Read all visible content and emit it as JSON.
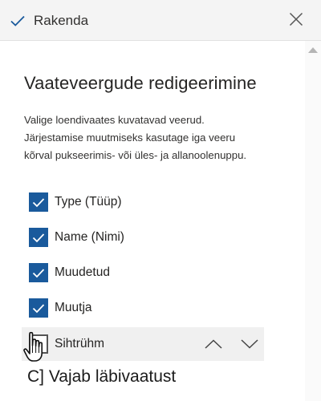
{
  "header": {
    "apply_label": "Rakenda",
    "apply_icon": "checkmark-icon",
    "close_icon": "close-icon"
  },
  "panel": {
    "title": "Vaateveergude redigeerimine",
    "description": "Valige loendivaates kuvatavad veerud. Järjestamise muutmiseks kasutage iga veeru kõrval pukseerimis- või üles- ja allanoolenuppu.",
    "columns": [
      {
        "label": "Type (Tüüp)",
        "checked": true
      },
      {
        "label": "Name (Nimi)",
        "checked": true
      },
      {
        "label": "Muudetud",
        "checked": true
      },
      {
        "label": "Muutja",
        "checked": true
      },
      {
        "label": "Sihtrühm",
        "checked": false
      }
    ],
    "move_up_icon": "chevron-up-icon",
    "move_down_icon": "chevron-down-icon"
  },
  "caption": "C] Vajab läbivaatust",
  "colors": {
    "accent": "#1a5a9c",
    "topbar": "#f4f4f4",
    "hover_row": "#f0f0f0"
  }
}
